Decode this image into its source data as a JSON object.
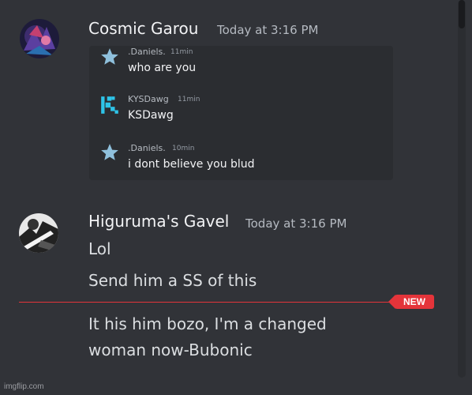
{
  "messages": [
    {
      "author": "Cosmic Garou",
      "timestamp": "Today at 3:16 PM",
      "quoted": [
        {
          "name": ".Daniels.",
          "time": "11min",
          "text": "who are you",
          "icon": "star-icon"
        },
        {
          "name": "KYSDawg",
          "time": "11min",
          "text": "KSDawg",
          "icon": "k-logo-icon"
        },
        {
          "name": ".Daniels.",
          "time": "10min",
          "text": "i dont believe you blud",
          "icon": "star-icon"
        }
      ]
    },
    {
      "author": "Higuruma's Gavel",
      "timestamp": "Today at 3:16 PM",
      "lines": [
        "Lol",
        "Send him a SS of this"
      ],
      "after_new": [
        "It his him bozo, I'm a changed",
        "woman now-Bubonic"
      ]
    }
  ],
  "new_label": "NEW",
  "watermark": "imgflip.com",
  "colors": {
    "background": "#313338",
    "embed": "#2b2d31",
    "new_accent": "#e4343a",
    "star": "#8fc0dc",
    "k_logo": "#2ec4e8"
  }
}
